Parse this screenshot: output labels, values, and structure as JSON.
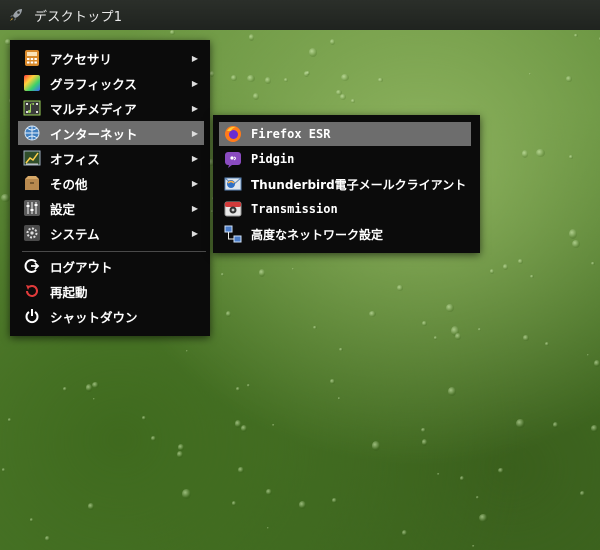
{
  "taskbar": {
    "title": "デスクトップ1",
    "launcher_icon": "rocket-icon"
  },
  "menu": {
    "items": [
      {
        "label": "アクセサリ",
        "icon": "accessories-icon",
        "arrow": "▶"
      },
      {
        "label": "グラフィックス",
        "icon": "graphics-icon",
        "arrow": "▶"
      },
      {
        "label": "マルチメディア",
        "icon": "multimedia-icon",
        "arrow": "▶"
      },
      {
        "label": "インターネット",
        "icon": "internet-icon",
        "arrow": "▶"
      },
      {
        "label": "オフィス",
        "icon": "office-icon",
        "arrow": "▶"
      },
      {
        "label": "その他",
        "icon": "other-icon",
        "arrow": "▶"
      },
      {
        "label": "設定",
        "icon": "settings-icon",
        "arrow": "▶"
      },
      {
        "label": "システム",
        "icon": "system-icon",
        "arrow": "▶"
      }
    ],
    "actions": [
      {
        "label": "ログアウト",
        "icon": "logout-icon"
      },
      {
        "label": "再起動",
        "icon": "restart-icon"
      },
      {
        "label": "シャットダウン",
        "icon": "power-icon"
      }
    ]
  },
  "submenu": {
    "items": [
      {
        "label": "Firefox ESR",
        "icon": "firefox-icon"
      },
      {
        "label": "Pidgin",
        "icon": "pidgin-icon"
      },
      {
        "label": "Thunderbird電子メールクライアント",
        "icon": "thunderbird-icon"
      },
      {
        "label": "Transmission",
        "icon": "transmission-icon"
      },
      {
        "label": "高度なネットワーク設定",
        "icon": "network-icon"
      }
    ]
  },
  "colors": {
    "menu_bg": "#0b0b0b",
    "highlight": "#6d6d6d",
    "desktop": "#5b8735"
  }
}
